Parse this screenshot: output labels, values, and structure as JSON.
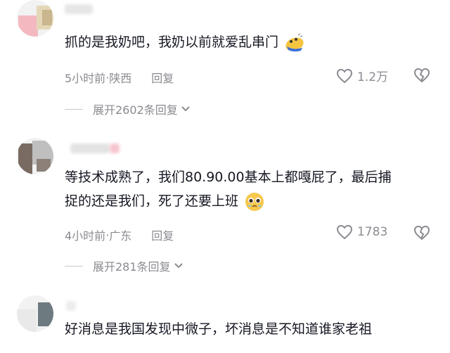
{
  "comments": [
    {
      "text": "抓的是我奶吧，我奶以前就爱乱串门",
      "time": "5小时前",
      "location": "陕西",
      "reply": "回复",
      "likes": "1.2万",
      "expand": "展开2602条回复",
      "emoji": "dizzy-face-emoji"
    },
    {
      "text_line1": "等技术成熟了，我们80.90.00基本上都嘎屁了，最后捕",
      "text_line2": "捉的还是我们，死了还要上班",
      "time": "4小时前",
      "location": "广东",
      "reply": "回复",
      "likes": "1783",
      "expand": "展开281条回复",
      "emoji": "pleading-face-emoji"
    },
    {
      "text": "好消息是我国发现中微子，坏消息是不知道谁家老祖"
    }
  ],
  "separator": " · ",
  "colors": {
    "text": "#161823",
    "meta": "#8a8b91"
  }
}
